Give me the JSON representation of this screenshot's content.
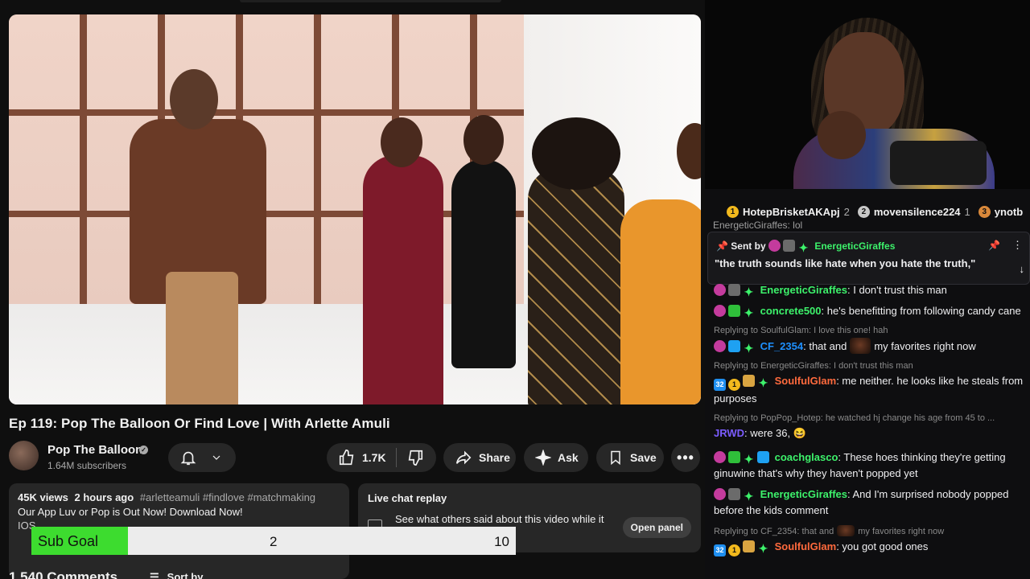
{
  "video": {
    "title": "Ep 119: Pop The Balloon Or Find Love | With Arlette Amuli"
  },
  "channel": {
    "name": "Pop The Balloon",
    "subscribers": "1.64M subscribers"
  },
  "actions": {
    "likes": "1.7K",
    "share": "Share",
    "ask": "Ask",
    "save": "Save"
  },
  "description": {
    "views": "45K views",
    "age": "2 hours ago",
    "tags": "#arletteamuli #findlove #matchmaking",
    "line1": "Our App Luv or Pop is Out Now! Download Now!",
    "line2": "IOS"
  },
  "chat_replay": {
    "heading": "Live chat replay",
    "text": "See what others said about this video while it",
    "button": "Open panel"
  },
  "comments": {
    "count": "1,540 Comments",
    "sort": "Sort by"
  },
  "sub_goal": {
    "label": "Sub Goal",
    "current": "2",
    "target": "10",
    "progress_fraction": 0.2,
    "color": "#3ddc2f"
  },
  "stream_chat": {
    "leaderboard": [
      {
        "rank_badge": "1",
        "name": "HotepBrisketAKApj",
        "count": "2",
        "color": "#f2b91d"
      },
      {
        "rank_badge": "2",
        "name": "movensilence224",
        "count": "1",
        "color": "#c8c8c8"
      },
      {
        "rank_badge": "3",
        "name": "ynotb",
        "count": "",
        "color": "#d9883a"
      }
    ],
    "partial_top": "EnergeticGiraffes: lol",
    "pinned": {
      "sent_by": "Sent by",
      "user": "EnergeticGiraffes",
      "message": "\"the truth sounds like hate when you hate the truth,\""
    },
    "messages": [
      {
        "user": "EnergeticGiraffes",
        "color": "#3df26b",
        "text": ": I don't trust this man",
        "reply": ""
      },
      {
        "user": "concrete500",
        "color": "#3df26b",
        "text": ": he's benefitting from following candy cane",
        "reply": ""
      },
      {
        "user": "CF_2354",
        "color": "#1e90ff",
        "text": ": that and",
        "text2": "my favorites right now",
        "reply": "Replying to SoulfulGlam: I love this one! hah"
      },
      {
        "user": "SoulfulGlam",
        "color": "#ff6a3d",
        "text": ": me neither. he looks like he steals from purposes",
        "reply": "Replying to EnergeticGiraffes: I don't trust this man"
      },
      {
        "user": "JRWD",
        "color": "#7b5cff",
        "text": ": were 36, 😆",
        "reply": "Replying to PopPop_Hotep: he watched hj change his age from 45 to ..."
      },
      {
        "user": "coachglasco",
        "color": "#3df26b",
        "text": ": These hoes thinking they're getting ginuwine that's why they haven't popped yet",
        "reply": ""
      },
      {
        "user": "EnergeticGiraffes",
        "color": "#3df26b",
        "text": ": And I'm surprised nobody popped before the kids comment",
        "reply": ""
      },
      {
        "user": "SoulfulGlam",
        "color": "#ff6a3d",
        "text": ": you got good ones",
        "reply": "Replying to CF_2354: that and",
        "reply2": "my favorites right now"
      }
    ]
  }
}
